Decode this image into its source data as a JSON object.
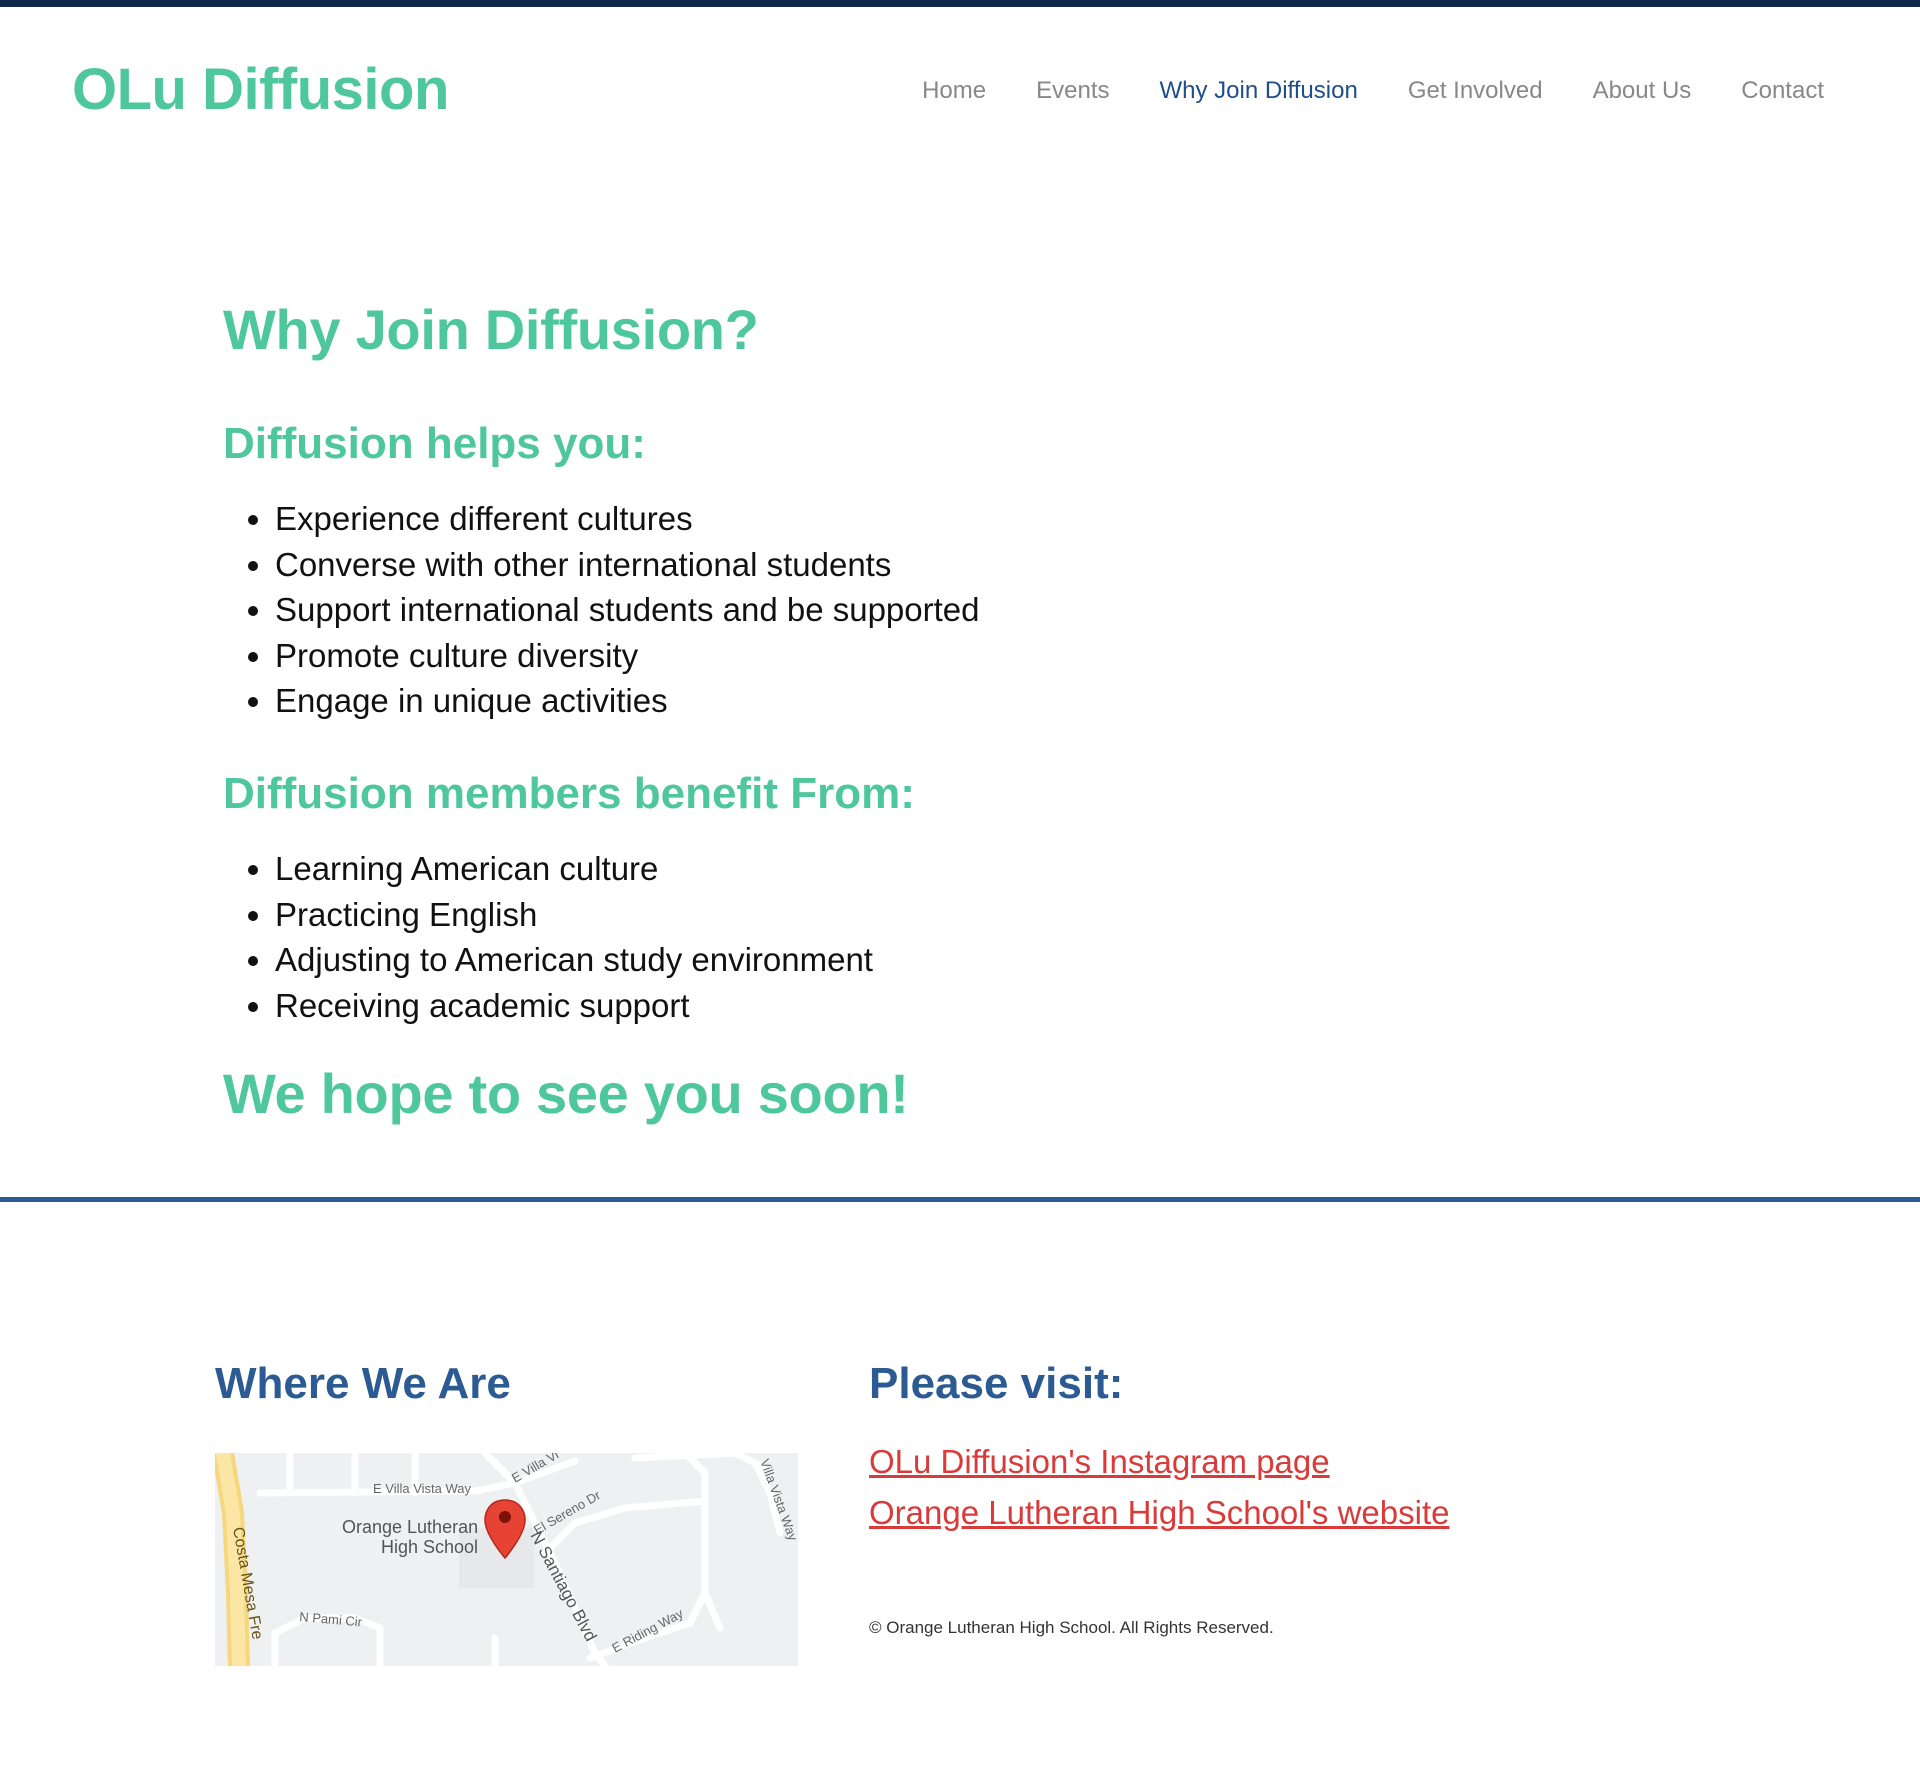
{
  "brand": "OLu Diffusion",
  "nav": {
    "items": [
      {
        "label": "Home"
      },
      {
        "label": "Events"
      },
      {
        "label": "Why Join Diffusion"
      },
      {
        "label": "Get Involved"
      },
      {
        "label": "About Us"
      },
      {
        "label": "Contact"
      }
    ],
    "active": "Why Join Diffusion"
  },
  "main": {
    "title": "Why Join Diffusion?",
    "section1": {
      "heading": "Diffusion helps you:",
      "items": [
        "Experience different cultures",
        "Converse with other international students",
        "Support international students and be supported",
        "Promote culture diversity",
        "Engage in unique activities"
      ]
    },
    "section2": {
      "heading": "Diffusion members benefit From:",
      "items": [
        "Learning American culture",
        "Practicing English",
        "Adjusting to American study environment",
        "Receiving academic support"
      ]
    },
    "closing": "We hope to see you soon!"
  },
  "footer": {
    "where_heading": "Where We Are",
    "map": {
      "place_line1": "Orange Lutheran",
      "place_line2": "High School",
      "streets": [
        "E Villa Vista Way",
        "E Villa Vi",
        "Villa Vista Way",
        "N Santiago Blvd",
        "El Sereno Dr",
        "Costa Mesa Fre",
        "N Pami Cir",
        "E Riding Way",
        "N"
      ],
      "pin_icon": "map-pin-icon"
    },
    "visit_heading": "Please visit:",
    "links": [
      "OLu Diffusion's Instagram page",
      "Orange Lutheran High School's website"
    ],
    "copyright": "© Orange Lutheran High School. All Rights Reserved."
  },
  "colors": {
    "brand_green": "#4ec79c",
    "nav_active": "#1f4e8c",
    "footer_blue": "#2c5a92",
    "link_red": "#d93a3a",
    "top_bar": "#10294a"
  }
}
